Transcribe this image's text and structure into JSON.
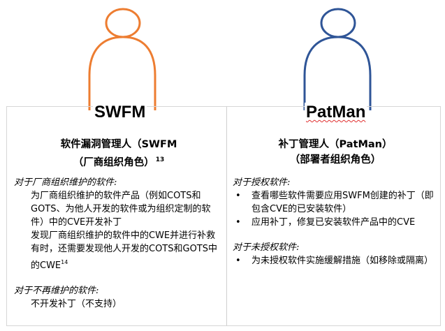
{
  "left": {
    "role": "SWFM",
    "title_line1": "软件漏洞管理人（SWFM",
    "title_line2": "（厂商组织角色）",
    "title_footnote": "13",
    "color": "#ED7D31",
    "section1_heading": "对于厂商组织维护的软件:",
    "section1_items": [
      "为厂商组织维护的软件产品（例如COTS和GOTS、为他人开发的软件或为组织定制的软件）中的CVE开发补丁",
      "发现厂商组织维护的软件中的CWE并进行补救",
      "有时，还需要发现他人开发的COTS和GOTS中的CWE"
    ],
    "section1_footnote": "14",
    "section2_heading": "对于不再维护的软件:",
    "section2_items": [
      "不开发补丁（不支持）"
    ]
  },
  "right": {
    "role": "PatMan",
    "title_line1": "补丁管理人（PatMan）",
    "title_line2": "（部署者组织角色）",
    "color": "#2F5597",
    "section1_heading": "对于授权软件:",
    "section1_items": [
      "查看哪些软件需要应用SWFM创建的补丁（即包含CVE的已安装软件）",
      "应用补丁，修复已安装软件产品中的CVE"
    ],
    "section2_heading": "对于未授权软件:",
    "section2_items": [
      "为未授权软件实施缓解措施（如移除或隔离）"
    ]
  }
}
